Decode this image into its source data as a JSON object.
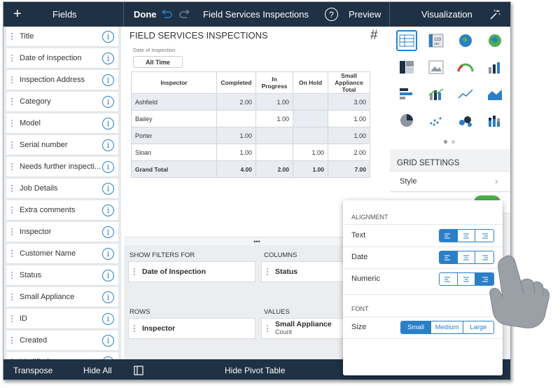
{
  "topbar": {
    "add_label": "+",
    "fields_title": "Fields",
    "done_label": "Done",
    "title": "Field Services Inspections",
    "help_label": "?",
    "preview_label": "Preview",
    "visualization_title": "Visualization"
  },
  "fields": [
    "Title",
    "Date of Inspection",
    "Inspection Address",
    "Category",
    "Model",
    "Serial number",
    "Needs further inspecti...",
    "Job Details",
    "Extra comments",
    "Inspector",
    "Customer Name",
    "Status",
    "Small Appliance",
    "ID",
    "Created",
    "Modified"
  ],
  "dashboard": {
    "title": "FIELD SERVICES INSPECTIONS",
    "filter_label": "Date of Inspection",
    "filter_value": "All Time",
    "hash_label": "#",
    "more_label": "•••"
  },
  "pivot": {
    "headers": [
      "Inspector",
      "Completed",
      "In Progress",
      "On Hold",
      "Small Appliance Total"
    ],
    "rows": [
      [
        "Ashfield",
        "2.00",
        "1.00",
        "",
        "3.00"
      ],
      [
        "Bailey",
        "",
        "1.00",
        "",
        "1.00"
      ],
      [
        "Porter",
        "1.00",
        "",
        "",
        "1.00"
      ],
      [
        "Sloan",
        "1.00",
        "",
        "1.00",
        "2.00"
      ],
      [
        "Grand Total",
        "4.00",
        "2.00",
        "1.00",
        "7.00"
      ]
    ]
  },
  "zones": {
    "filters_title": "SHOW FILTERS FOR",
    "filters_pill": "Date of Inspection",
    "columns_title": "COLUMNS",
    "columns_pill": "Status",
    "rows_title": "ROWS",
    "rows_pill": "Inspector",
    "values_title": "VALUES",
    "values_pill": "Small Appliance",
    "values_sub": "Count"
  },
  "right_panel": {
    "grid_settings_title": "GRID SETTINGS",
    "style_label": "Style",
    "viz_icons": [
      "grid-icon",
      "text-icon",
      "map-pin-icon",
      "treemap-icon",
      "pivot-icon",
      "image-icon",
      "gauge-icon",
      "column-icon",
      "bar-icon",
      "combo-icon",
      "line-icon",
      "area-icon",
      "pie-icon",
      "scatter-icon",
      "bubble-icon",
      "stacked-column-icon"
    ]
  },
  "popup": {
    "alignment_title": "ALIGNMENT",
    "text_label": "Text",
    "date_label": "Date",
    "numeric_label": "Numeric",
    "font_title": "FONT",
    "size_label": "Size",
    "size_options": [
      "Small",
      "Medium",
      "Large"
    ],
    "text_selected": "left",
    "date_selected": "left",
    "numeric_selected": "right",
    "size_selected": "Small"
  },
  "bottombar": {
    "transpose_label": "Transpose",
    "hide_all_label": "Hide All",
    "hide_pivot_label": "Hide Pivot Table"
  },
  "colors": {
    "navy": "#1e3145",
    "accent": "#2b7fc7",
    "toggle": "#4caf50"
  }
}
